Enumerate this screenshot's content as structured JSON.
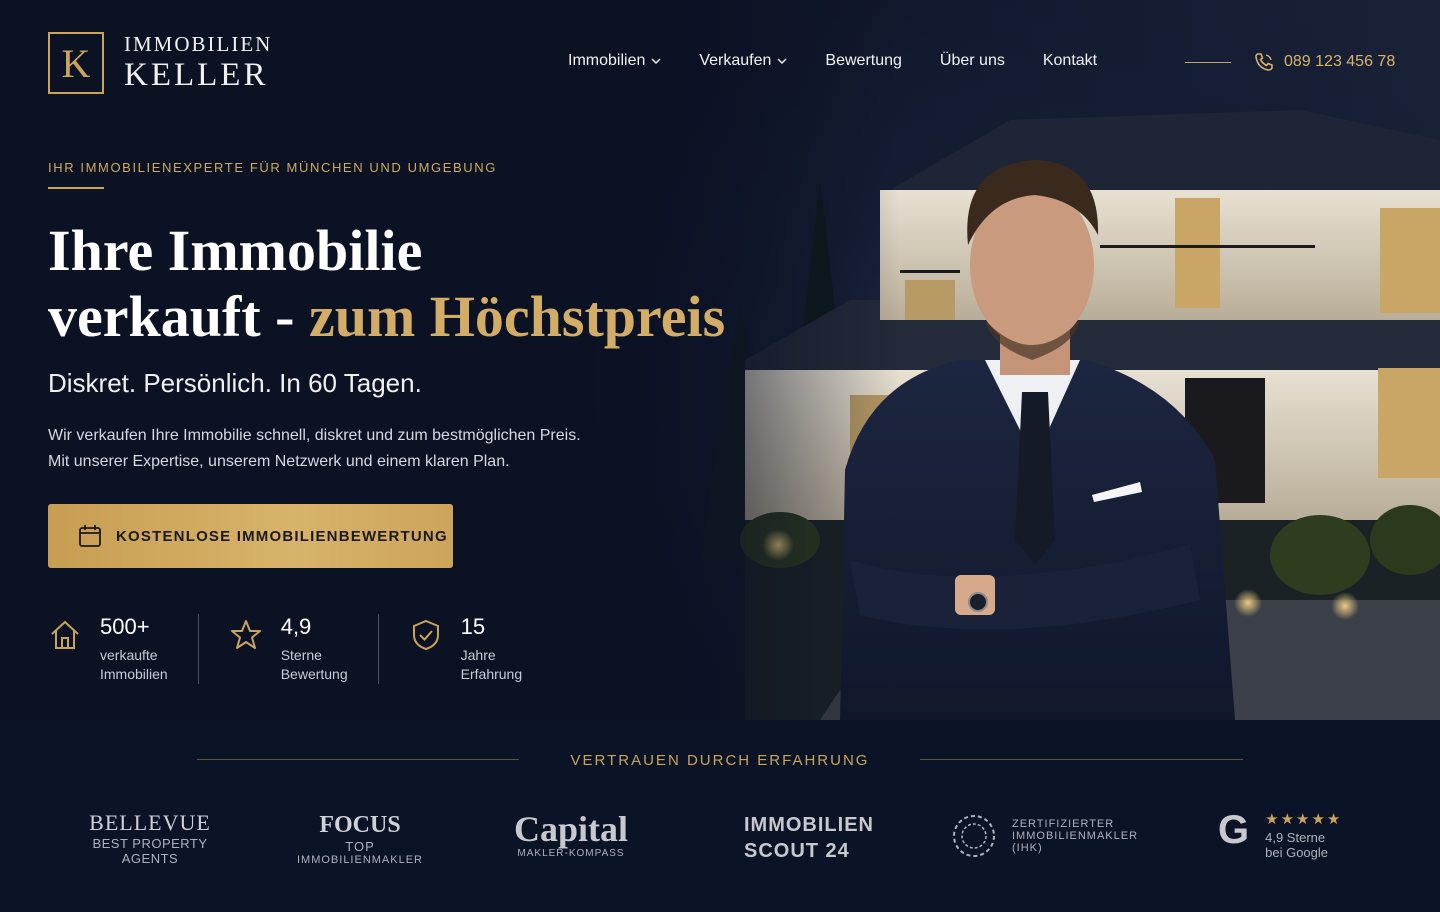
{
  "header": {
    "logo_mark": "K",
    "logo_line1": "IMMOBILIEN",
    "logo_line2": "KELLER",
    "nav": [
      {
        "label": "Immobilien",
        "dropdown": true
      },
      {
        "label": "Verkaufen",
        "dropdown": true
      },
      {
        "label": "Bewertung",
        "dropdown": false
      },
      {
        "label": "Über uns",
        "dropdown": false
      },
      {
        "label": "Kontakt",
        "dropdown": false
      }
    ],
    "phone": "089 123 456 78"
  },
  "hero": {
    "eyebrow": "IHR IMMOBILIENEXPERTE FÜR MÜNCHEN UND UMGEBUNG",
    "headline_line1": "Ihre Immobilie",
    "headline_line2_start": "verkauft - ",
    "headline_line2_gold": "zum Höchstpreis",
    "subhead": "Diskret. Persönlich. In 60 Tagen.",
    "body_line1": "Wir verkaufen Ihre Immobilie schnell, diskret und zum bestmöglichen Preis.",
    "body_line2": "Mit unserer Expertise, unserem Netzwerk und einem klaren Plan.",
    "cta_label": "KOSTENLOSE IMMOBILIENBEWERTUNG",
    "stats": [
      {
        "value": "500+",
        "label1": "verkaufte",
        "label2": "Immobilien",
        "icon": "house-icon"
      },
      {
        "value": "4,9",
        "label1": "Sterne",
        "label2": "Bewertung",
        "icon": "star-icon"
      },
      {
        "value": "15",
        "label1": "Jahre",
        "label2": "Erfahrung",
        "icon": "shield-check-icon"
      }
    ]
  },
  "trust": {
    "title": "VERTRAUEN DURCH ERFAHRUNG",
    "partners": {
      "bellevue": {
        "name": "BELLEVUE",
        "sub1": "BEST PROPERTY",
        "sub2": "AGENTS"
      },
      "focus": {
        "name": "FOCUS",
        "sub1": "TOP",
        "sub2": "IMMOBILIENMAKLER"
      },
      "capital": {
        "name": "Capital",
        "sub1": "MAKLER-KOMPASS"
      },
      "scout": {
        "name1": "IMMOBILIEN",
        "name2": "SCOUT 24"
      },
      "ihk": {
        "line1": "ZERTIFIZIERTER",
        "line2": "IMMOBILIENMAKLER",
        "line3": "(IHK)"
      },
      "google": {
        "letter": "G",
        "stars": "★★★★★",
        "rating": "4,9 Sterne",
        "sub": "bei Google"
      }
    }
  },
  "colors": {
    "accent": "#c9a45a",
    "background": "#0a1122"
  }
}
